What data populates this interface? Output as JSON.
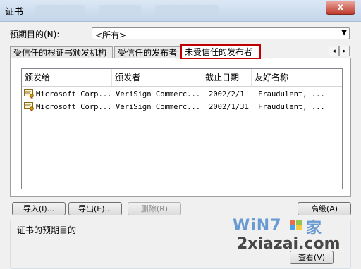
{
  "window": {
    "title": "证书",
    "close": "x"
  },
  "purpose": {
    "label": "预期目的(N):",
    "value": "<所有>"
  },
  "tabs": [
    {
      "label": "受信任的根证书颁发机构"
    },
    {
      "label": "受信任的发布者"
    },
    {
      "label": "未受信任的发布者"
    }
  ],
  "tab_scroll": {
    "left": "◂",
    "right": "▸"
  },
  "list": {
    "columns": [
      "颁发给",
      "颁发者",
      "截止日期",
      "友好名称"
    ],
    "rows": [
      [
        "Microsoft Corp...",
        "VeriSign Commerc...",
        "2002/2/1",
        "Fraudulent, ..."
      ],
      [
        "Microsoft Corp...",
        "VeriSign Commerc...",
        "2002/1/31",
        "Fraudulent, ..."
      ]
    ]
  },
  "buttons": {
    "import": "导入(I)...",
    "export": "导出(E)...",
    "remove": "删除(R)",
    "advanced": "高级(A)",
    "view": "查看(V)"
  },
  "purposes_group": {
    "label": "证书的预期目的"
  },
  "watermark": {
    "line1": "WiN7",
    "logo_text": "家",
    "line2": "2xiazai.com"
  }
}
